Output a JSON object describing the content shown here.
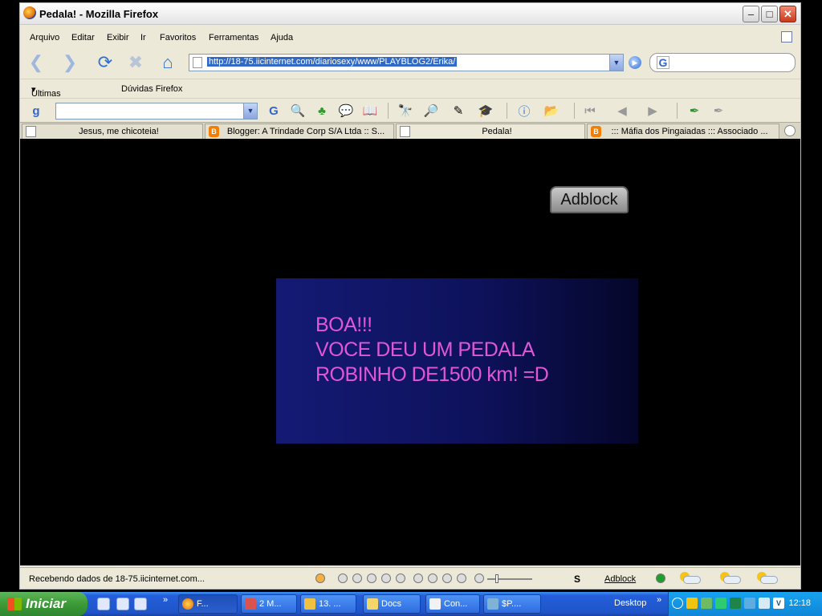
{
  "window": {
    "title": "Pedala! - Mozilla Firefox"
  },
  "menu": [
    "Arquivo",
    "Editar",
    "Exibir",
    "Ir",
    "Favoritos",
    "Ferramentas",
    "Ajuda"
  ],
  "address": {
    "url": "http://18-75.iicinternet.com/diariosexy/www/PLAYBLOG2/Erika/"
  },
  "bookmarks": {
    "item1": "Últimas notícias",
    "item2": "Dúvidas Firefox"
  },
  "tabs": [
    {
      "label": "Jesus, me chicoteia!",
      "icon": "page-icon"
    },
    {
      "label": "Blogger: A Trindade Corp S/A Ltda :: S...",
      "icon": "blogger-icon"
    },
    {
      "label": "Pedala!",
      "icon": "page-icon"
    },
    {
      "label": "::: Máfia dos Pingaiadas ::: Associado ...",
      "icon": "blogger-icon"
    }
  ],
  "page": {
    "adblock_label": "Adblock",
    "banner_lines": [
      "BOA!!!",
      "VOCE DEU UM PEDALA",
      "ROBINHO DE1500 km! =D"
    ]
  },
  "status": {
    "text": "Recebendo dados de 18-75.iicinternet.com...",
    "adblock_label": "Adblock"
  },
  "taskbar": {
    "start_label": "Iniciar",
    "buttons": [
      "F...",
      "2 M...",
      "13. ...",
      "Docs",
      "Con...",
      "$P...."
    ],
    "desktop_label": "Desktop",
    "clock": "12:18"
  },
  "colors": {
    "banner_text": "#e257d8",
    "banner_bg": "#141a74",
    "taskbar": "#245edb",
    "start": "#3c9a37"
  }
}
